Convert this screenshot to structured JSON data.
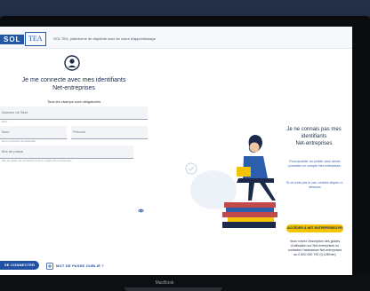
{
  "header": {
    "logo_sol": "SOL",
    "logo_tea": "TEA",
    "description": "SOL TEA, plateforme de dépôt/de suivi de cours d'apprentissage"
  },
  "login": {
    "title_line1": "Je me connecte avec mes identifiants",
    "title_line2": "Net-entreprises",
    "required_note": "Tous les champs sont obligatoires",
    "siret_placeholder": "Numéro de Siret",
    "siret_hint": "Siret",
    "name_placeholder": "Nom",
    "firstname_placeholder": "Prénom",
    "name_hint": "Nom et prénom du déclarant",
    "password_placeholder": "Mot de passe",
    "password_hint": "Mot de passe de connexion à votre espace Net-entreprises",
    "connect_button": "SE CONNECTER",
    "forgot_link": "MOT DE PASSE OUBLIÉ ?"
  },
  "register": {
    "title_line1": "Je ne connais pas mes",
    "title_line2": "identifiants",
    "title_line3": "Net-entreprises",
    "para1": "Pour accéder au portail, vous devez posséder un compte Net-entreprises.",
    "para2": "Si ce n'est pas le cas, veuillez cliquer ci-dessous",
    "access_button": "ACCÉDER À NET-ENTREPRISES.FR",
    "para3": "Vous n'avez l'inscription des guides d'utilisation sur Net-entreprises ou contactez l'assistance Net-entreprises au 0 820 000 792 (0,12€/min)"
  },
  "footer": {
    "device_label": "MacBook"
  },
  "colors": {
    "primary": "#2151a3",
    "accent": "#f5c400",
    "title": "#1b2a4a"
  }
}
